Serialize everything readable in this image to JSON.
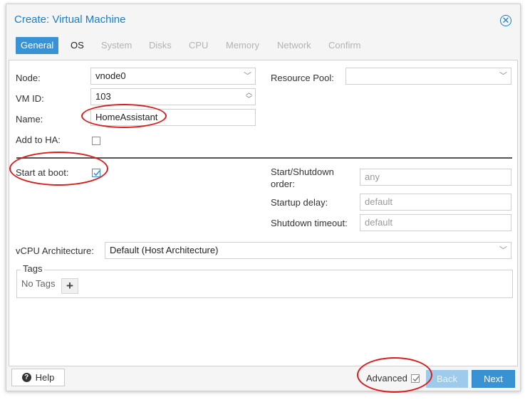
{
  "window": {
    "title": "Create: Virtual Machine"
  },
  "tabs": [
    {
      "label": "General",
      "state": "active"
    },
    {
      "label": "OS",
      "state": "enabled"
    },
    {
      "label": "System",
      "state": "disabled"
    },
    {
      "label": "Disks",
      "state": "disabled"
    },
    {
      "label": "CPU",
      "state": "disabled"
    },
    {
      "label": "Memory",
      "state": "disabled"
    },
    {
      "label": "Network",
      "state": "disabled"
    },
    {
      "label": "Confirm",
      "state": "disabled"
    }
  ],
  "form": {
    "node": {
      "label": "Node:",
      "value": "vnode0"
    },
    "vmid": {
      "label": "VM ID:",
      "value": "103"
    },
    "name": {
      "label": "Name:",
      "value": "HomeAssistant"
    },
    "add_ha": {
      "label": "Add to HA:",
      "checked": false
    },
    "resource_pool": {
      "label": "Resource Pool:",
      "value": ""
    },
    "start_at_boot": {
      "label": "Start at boot:",
      "checked": true
    },
    "startup_order": {
      "label_line1": "Start/Shutdown",
      "label_line2": "order:",
      "placeholder": "any"
    },
    "startup_delay": {
      "label": "Startup delay:",
      "placeholder": "default"
    },
    "shutdown_timeout": {
      "label": "Shutdown timeout:",
      "placeholder": "default"
    },
    "vcpu_arch": {
      "label": "vCPU Architecture:",
      "value": "Default (Host Architecture)"
    },
    "tags": {
      "legend": "Tags",
      "empty_text": "No Tags"
    }
  },
  "footer": {
    "help_label": "Help",
    "advanced_label": "Advanced",
    "advanced_checked": true,
    "back_label": "Back",
    "next_label": "Next"
  },
  "colors": {
    "accent": "#3892d4",
    "title": "#157fcc",
    "annotation": "#d91d1d"
  }
}
